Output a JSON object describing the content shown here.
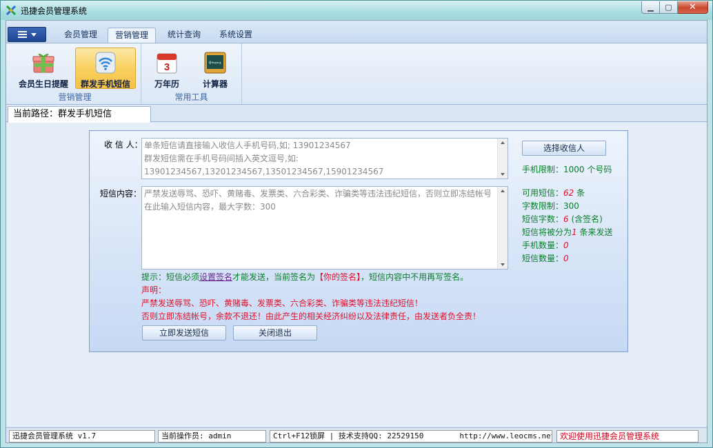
{
  "window": {
    "title": "迅捷会员管理系统"
  },
  "tabs": [
    {
      "label": "会员管理"
    },
    {
      "label": "营销管理"
    },
    {
      "label": "统计查询"
    },
    {
      "label": "系统设置"
    }
  ],
  "ribbon": {
    "groups": [
      {
        "label": "营销管理",
        "buttons": [
          {
            "label": "会员生日提醒",
            "icon": "gift-icon"
          },
          {
            "label": "群发手机短信",
            "icon": "wireless-signal-icon"
          }
        ]
      },
      {
        "label": "常用工具",
        "buttons": [
          {
            "label": "万年历",
            "icon": "calendar-icon",
            "day": "3"
          },
          {
            "label": "计算器",
            "icon": "calculator-icon",
            "screen_text": "0+∞=±"
          }
        ]
      }
    ]
  },
  "doc_tab": {
    "label": "当前路径：群发手机短信"
  },
  "form": {
    "recipient_label": "收 信 人：",
    "recipient_placeholder_lines": [
      "单条短信请直接输入收信人手机号码,如; 13901234567",
      "群发短信需在手机号码间插入英文逗号,如:",
      "13901234567,13201234567,13501234567,15901234567"
    ],
    "content_label": "短信内容：",
    "content_placeholder_lines": [
      "严禁发送辱骂、恐吓、黄赌毒、发票类、六合彩类、诈骗类等违法违纪短信，否则立即冻结帐号",
      "在此输入短信内容，最大字数：300"
    ],
    "select_recipient_button": "选择收信人",
    "phone_limit": "手机限制：1000 个号码",
    "stats": {
      "available_sms_prefix": "可用短信：",
      "available_sms_value": "62",
      "available_sms_suffix": " 条",
      "char_limit": "字数限制：300",
      "sms_chars_prefix": "短信字数：",
      "sms_chars_value": "6",
      "sms_chars_suffix": " (含签名)",
      "split_prefix": "短信将被分为",
      "split_value": "1",
      "split_suffix": " 条来发送",
      "phone_count_prefix": "手机数量：",
      "phone_count_value": "0",
      "sms_count_prefix": "短信数量：",
      "sms_count_value": "0"
    },
    "tip": {
      "prefix": "提示：短信必须",
      "link": "设置签名",
      "middle": "才能发送，当前签名为",
      "signature": "【你的签名】",
      "suffix": "，短信内容中不用再写签名。"
    },
    "declaration": {
      "title": "声明：",
      "line1": "严禁发送辱骂、恐吓、黄赌毒、发票类、六合彩类、诈骗类等违法违纪短信！",
      "line2": "否则立即冻结帐号，余款不退还！由此产生的相关经济纠纷以及法律责任，由发送者负全责！"
    },
    "send_button": "立即发送短信",
    "close_button": "关闭退出"
  },
  "status": {
    "version": "迅捷会员管理系统 v1.7",
    "operator": "当前操作员: admin",
    "lock": "Ctrl+F12锁屏 | 技术支持QQ:  22529150",
    "url": "http://www.leocms.net",
    "welcome": "欢迎使用迅捷会员管理系统"
  }
}
